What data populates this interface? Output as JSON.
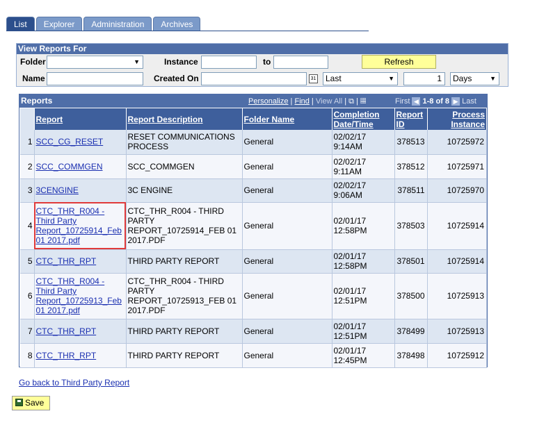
{
  "tabs": [
    "List",
    "Explorer",
    "Administration",
    "Archives"
  ],
  "criteria": {
    "title": "View Reports For",
    "folder_label": "Folder",
    "folder_value": "",
    "instance_label": "Instance",
    "instance_from": "",
    "to_label": "to",
    "instance_to": "",
    "refresh_label": "Refresh",
    "name_label": "Name",
    "name_value": "",
    "created_on_label": "Created On",
    "created_on_value": "",
    "calendar_text": "31",
    "period_value": "Last",
    "count_value": "1",
    "unit_value": "Days"
  },
  "grid": {
    "title": "Reports",
    "personalize": "Personalize",
    "find": "Find",
    "view_all": "View All",
    "first": "First",
    "range": "1-8 of 8",
    "last": "Last",
    "columns": [
      "Report",
      "Report Description",
      "Folder Name",
      "Completion Date/Time",
      "Report ID",
      "Process Instance"
    ],
    "rows": [
      {
        "n": "1",
        "report": "SCC_CG_RESET",
        "desc": "RESET COMMUNICATIONS PROCESS",
        "folder": "General",
        "date": "02/02/17",
        "time": "9:14AM",
        "id": "378513",
        "instance": "10725972"
      },
      {
        "n": "2",
        "report": "SCC_COMMGEN",
        "desc": "SCC_COMMGEN",
        "folder": "General",
        "date": "02/02/17",
        "time": "9:11AM",
        "id": "378512",
        "instance": "10725971"
      },
      {
        "n": "3",
        "report": "3CENGINE",
        "desc": "3C ENGINE",
        "folder": "General",
        "date": "02/02/17",
        "time": "9:06AM",
        "id": "378511",
        "instance": "10725970"
      },
      {
        "n": "4",
        "report": "CTC_THR_R004 - Third Party Report_10725914_Feb 01 2017.pdf",
        "desc": "CTC_THR_R004 - THIRD PARTY REPORT_10725914_FEB 01 2017.PDF",
        "folder": "General",
        "date": "02/01/17",
        "time": "12:58PM",
        "id": "378503",
        "instance": "10725914"
      },
      {
        "n": "5",
        "report": "CTC_THR_RPT",
        "desc": "THIRD PARTY REPORT",
        "folder": "General",
        "date": "02/01/17",
        "time": "12:58PM",
        "id": "378501",
        "instance": "10725914"
      },
      {
        "n": "6",
        "report": "CTC_THR_R004 - Third Party Report_10725913_Feb 01 2017.pdf",
        "desc": "CTC_THR_R004 - THIRD PARTY REPORT_10725913_FEB 01 2017.PDF",
        "folder": "General",
        "date": "02/01/17",
        "time": "12:51PM",
        "id": "378500",
        "instance": "10725913"
      },
      {
        "n": "7",
        "report": "CTC_THR_RPT",
        "desc": "THIRD PARTY REPORT",
        "folder": "General",
        "date": "02/01/17",
        "time": "12:51PM",
        "id": "378499",
        "instance": "10725913"
      },
      {
        "n": "8",
        "report": "CTC_THR_RPT",
        "desc": "THIRD PARTY REPORT",
        "folder": "General",
        "date": "02/01/17",
        "time": "12:45PM",
        "id": "378498",
        "instance": "10725912"
      }
    ]
  },
  "go_back": "Go back to Third Party Report",
  "save_label": "Save"
}
